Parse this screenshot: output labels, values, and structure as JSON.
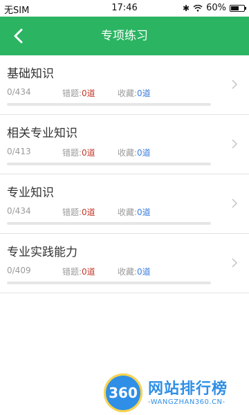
{
  "statusbar": {
    "carrier": "无SIM",
    "time": "17:46",
    "battery": "60%",
    "battery_level": 0.6
  },
  "header": {
    "title": "专项练习"
  },
  "items": [
    {
      "name": "基础知识",
      "progress": "0/434",
      "error_label": "错题:",
      "error_count": "0道",
      "fav_label": "收藏:",
      "fav_count": "0道",
      "progress_fraction": 0
    },
    {
      "name": "相关专业知识",
      "progress": "0/413",
      "error_label": "错题:",
      "error_count": "0道",
      "fav_label": "收藏:",
      "fav_count": "0道",
      "progress_fraction": 0
    },
    {
      "name": "专业知识",
      "progress": "0/434",
      "error_label": "错题:",
      "error_count": "0道",
      "fav_label": "收藏:",
      "fav_count": "0道",
      "progress_fraction": 0
    },
    {
      "name": "专业实践能力",
      "progress": "0/409",
      "error_label": "错题:",
      "error_count": "0道",
      "fav_label": "收藏:",
      "fav_count": "0道",
      "progress_fraction": 0
    }
  ],
  "watermark": {
    "logo": "360",
    "title": "网站排行榜",
    "url": "-WANGZHAN360.CN-"
  },
  "colors": {
    "primary": "#2bb462",
    "error": "#c0392b",
    "favorite": "#3b7ddd"
  }
}
